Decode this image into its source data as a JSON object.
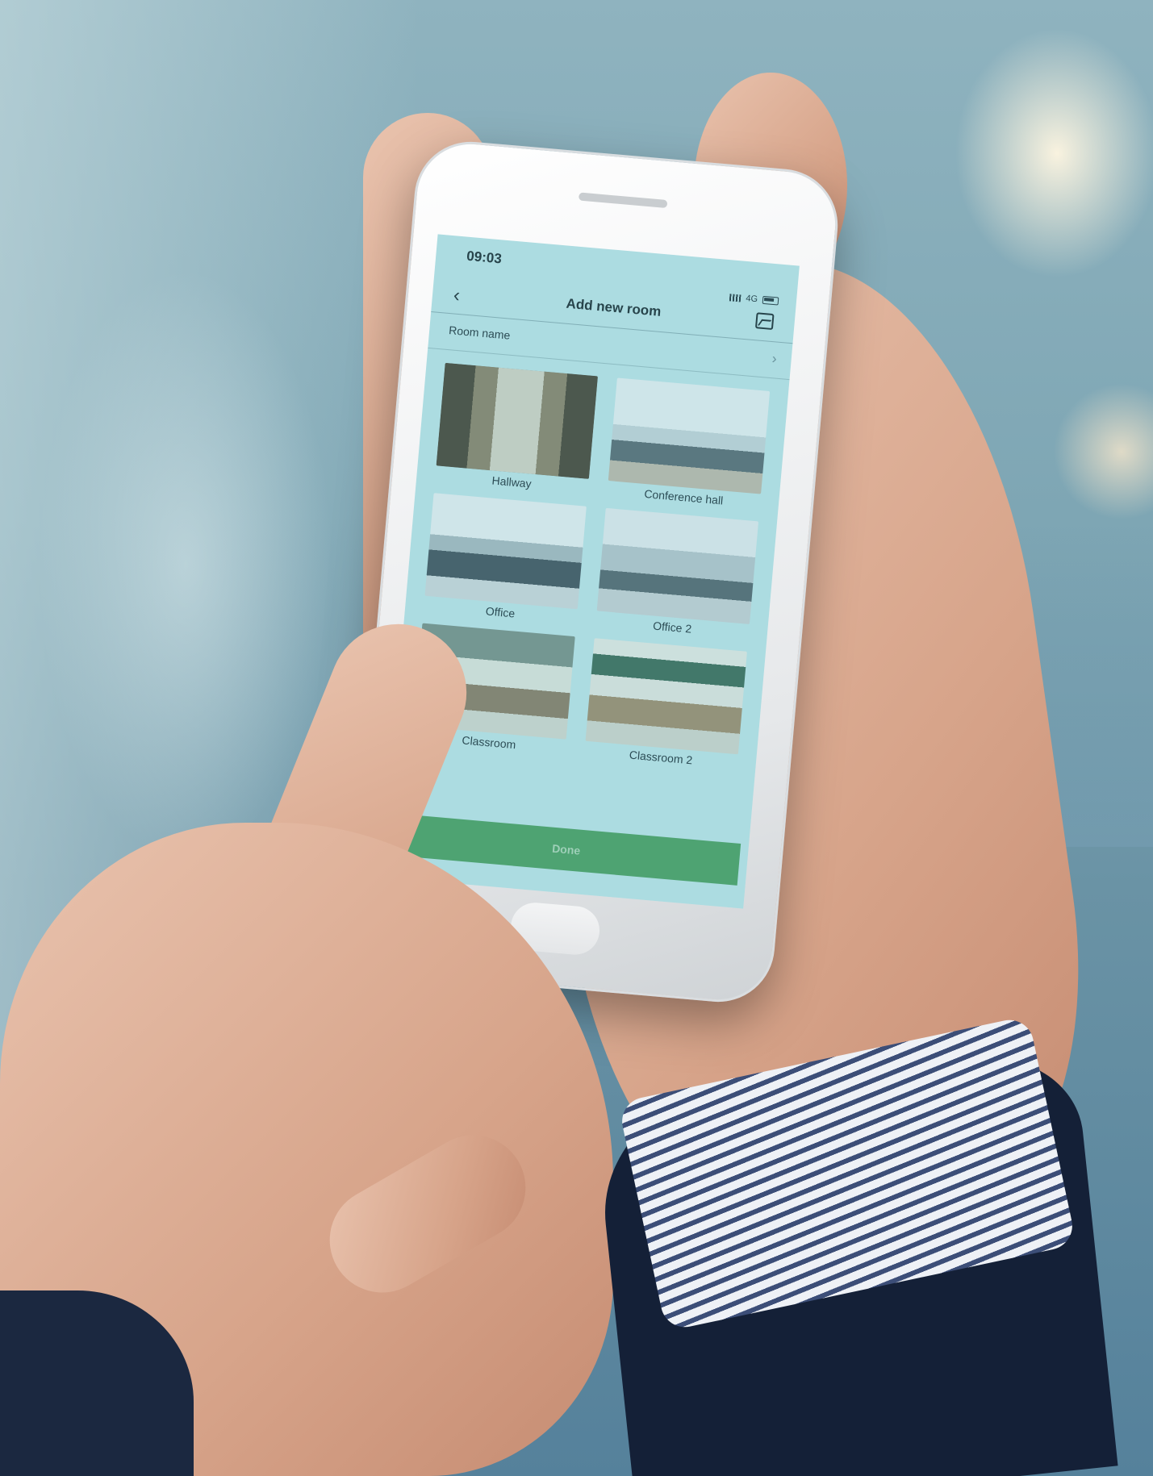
{
  "status_bar": {
    "time": "09:03",
    "network": "4G"
  },
  "nav": {
    "title": "Add new room"
  },
  "form": {
    "room_name_label": "Room name"
  },
  "rooms": [
    {
      "label": "Hallway"
    },
    {
      "label": "Conference hall"
    },
    {
      "label": "Office"
    },
    {
      "label": "Office 2"
    },
    {
      "label": "Classroom"
    },
    {
      "label": "Classroom 2"
    }
  ],
  "actions": {
    "done_label": "Done"
  },
  "colors": {
    "screen_tint": "#bfe3e6",
    "done_button": "#4c9e5e"
  }
}
